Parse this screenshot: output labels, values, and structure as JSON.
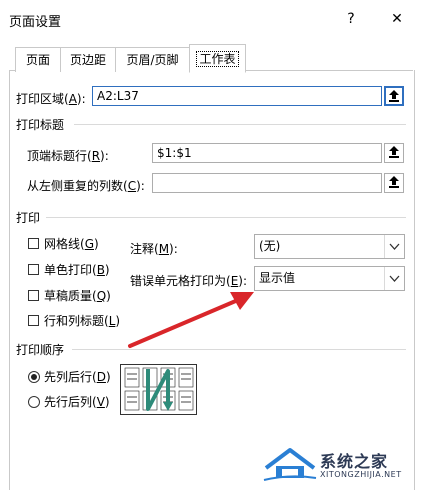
{
  "window": {
    "title": "页面设置",
    "help_label": "?",
    "close_label": "✕"
  },
  "tabs": [
    {
      "label": "页面",
      "active": false
    },
    {
      "label": "页边距",
      "active": false
    },
    {
      "label": "页眉/页脚",
      "active": false
    },
    {
      "label": "工作表",
      "active": true
    }
  ],
  "print_area": {
    "label": "打印区域(",
    "key": "A",
    "suffix": "):",
    "value": "A2:L37"
  },
  "print_titles": {
    "heading": "打印标题",
    "rows": {
      "label": "顶端标题行(",
      "key": "R",
      "suffix": "):",
      "value": "$1:$1"
    },
    "cols": {
      "label": "从左侧重复的列数(",
      "key": "C",
      "suffix": "):",
      "value": ""
    }
  },
  "print": {
    "heading": "打印",
    "checkboxes": [
      {
        "label": "网格线(",
        "key": "G",
        "suffix": ")",
        "checked": false
      },
      {
        "label": "单色打印(",
        "key": "B",
        "suffix": ")",
        "checked": false
      },
      {
        "label": "草稿质量(",
        "key": "Q",
        "suffix": ")",
        "checked": false
      },
      {
        "label": "行和列标题(",
        "key": "L",
        "suffix": ")",
        "checked": false
      }
    ],
    "comments": {
      "label": "注释(",
      "key": "M",
      "suffix": "):",
      "value": "(无)"
    },
    "errors": {
      "label": "错误单元格打印为(",
      "key": "E",
      "suffix": "):",
      "value": "显示值"
    }
  },
  "page_order": {
    "heading": "打印顺序",
    "options": [
      {
        "label": "先列后行(",
        "key": "D",
        "suffix": ")",
        "selected": true
      },
      {
        "label": "先行后列(",
        "key": "V",
        "suffix": ")",
        "selected": false
      }
    ]
  },
  "watermark": {
    "text": "系统之家",
    "url_text": "XITONGZHIJIA.NET"
  },
  "colors": {
    "accent": "#2f6fbf",
    "arrow": "#d9262a",
    "order_arrow": "#2e8b7a"
  }
}
